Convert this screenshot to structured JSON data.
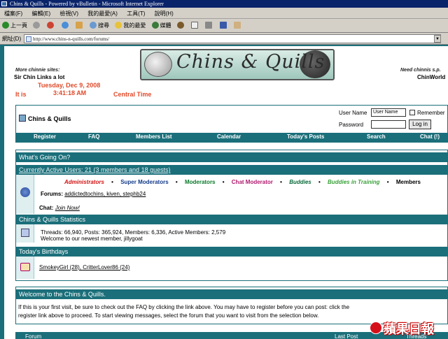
{
  "window": {
    "title": "Chins & Quills - Powered by vBulletin - Microsoft Internet Explorer"
  },
  "menubar": [
    "檔案(F)",
    "編輯(E)",
    "檢視(V)",
    "我的最愛(A)",
    "工具(T)",
    "說明(H)"
  ],
  "toolbar": {
    "back": "上一頁",
    "search": "搜尋",
    "favorites": "我的最愛",
    "media": "媒體"
  },
  "address": {
    "label": "網址(D)",
    "url": "http://www.chins-n-quills.com/forums/"
  },
  "banner": {
    "logo_text": "Chins & Quills",
    "more_sites": "More chinnie sites:",
    "sir_chin": "Sir Chin Links a lot",
    "date": "Tuesday, Dec 9, 2008",
    "time": "3:41:18 AM",
    "it_is": "It is",
    "central": "Central Time",
    "need_chinnis": "Need chinnis s.p.",
    "chinworld": "ChinWorld"
  },
  "nav": {
    "site_title": "Chins & Quills",
    "user_label": "User Name",
    "user_value": "User Name",
    "remember": "Remember",
    "pass_label": "Password",
    "login": "Log in",
    "links": [
      "Register",
      "FAQ",
      "Members List",
      "Calendar",
      "Today's Posts",
      "Search",
      "Chat (!)"
    ]
  },
  "wgo": {
    "header": "What's Going On?",
    "online": "Currently Active Users: 21 (3 members and 18 guests)",
    "legend": [
      {
        "label": "Administrators",
        "color": "#d01010",
        "italic": true
      },
      {
        "label": "Super Moderators",
        "color": "#123a8a",
        "italic": false
      },
      {
        "label": "Moderators",
        "color": "#0a7a2a",
        "italic": false
      },
      {
        "label": "Chat Moderator",
        "color": "#b0186e",
        "italic": false
      },
      {
        "label": "Buddies",
        "color": "#0a6a3a",
        "italic": true
      },
      {
        "label": "Buddies in Training",
        "color": "#3aa03a",
        "italic": true
      },
      {
        "label": "Members",
        "color": "#000000",
        "italic": false
      }
    ],
    "forums_label": "Forums:",
    "forums_users": "addictedtochins, kiven, stephb24",
    "chat_label": "Chat:",
    "chat_link": "Join Now!",
    "stats_header": "Chins & Quills Statistics",
    "stats_line": "Threads: 66,940, Posts: 365,924, Members: 6,336, Active Members: 2,579",
    "newest_line": "Welcome to our newest member, jillygoat",
    "bday_header": "Today's Birthdays",
    "bday_line": "SmokeyGirl (28), CritterLover86 (24)"
  },
  "welcome": {
    "header": "Welcome to the Chins & Quills.",
    "line1": "If this is your first visit, be sure to check out the FAQ by clicking the link above. You may have to register before you can post: click the",
    "line2": "register link above to proceed. To start viewing messages, select the forum that you want to visit from the selection below."
  },
  "bottom": {
    "forum": "Forum",
    "last_post": "Last Post",
    "threads": "Threads",
    "posts": "Posts"
  },
  "watermark": "蘋果日報"
}
